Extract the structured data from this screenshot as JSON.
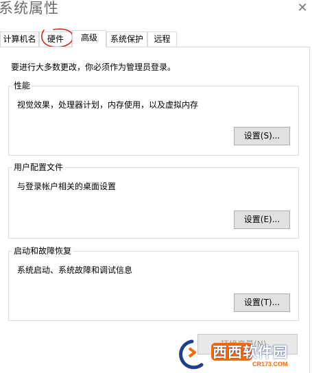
{
  "window": {
    "title": "系统属性"
  },
  "tabs": [
    {
      "label": "计算机名",
      "active": false
    },
    {
      "label": "硬件",
      "active": false
    },
    {
      "label": "高级",
      "active": true
    },
    {
      "label": "系统保护",
      "active": false
    },
    {
      "label": "远程",
      "active": false
    }
  ],
  "admin_note": "要进行大多数更改，你必须作为管理员登录。",
  "groups": {
    "performance": {
      "label": "性能",
      "description": "视觉效果，处理器计划，内存使用，以及虚拟内存",
      "button": "设置(S)..."
    },
    "user_profiles": {
      "label": "用户配置文件",
      "description": "与登录帐户相关的桌面设置",
      "button": "设置(E)..."
    },
    "startup_recovery": {
      "label": "启动和故障恢复",
      "description": "系统启动、系统故障和调试信息",
      "button": "设置(T)..."
    }
  },
  "env_button": "环境变量(N)...",
  "watermark": {
    "text": "西西软件园",
    "sub": "CR173.COM"
  },
  "colors": {
    "annotation_circle": "#d42020",
    "watermark_orange": "#ff6a00"
  }
}
